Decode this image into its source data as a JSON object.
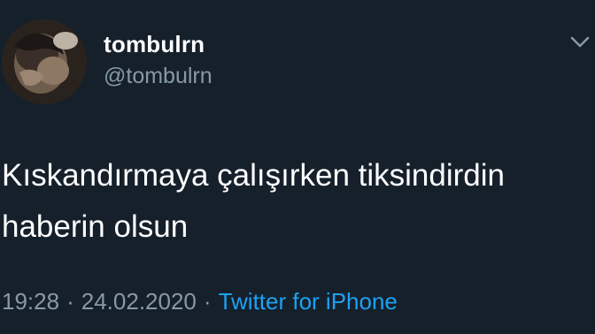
{
  "user": {
    "display_name": "tombulrn",
    "handle": "@tombulrn"
  },
  "tweet": {
    "text_line1": "Kıskandırmaya çalışırken tiksindirdin",
    "text_line2": "haberin olsun"
  },
  "meta": {
    "time": "19:28",
    "separator": "·",
    "date": "24.02.2020",
    "source": "Twitter for iPhone"
  },
  "icons": {
    "menu": "chevron-down-icon"
  },
  "colors": {
    "background": "#15202b",
    "text": "#ffffff",
    "muted": "#8899a6",
    "link": "#1da1f2"
  }
}
